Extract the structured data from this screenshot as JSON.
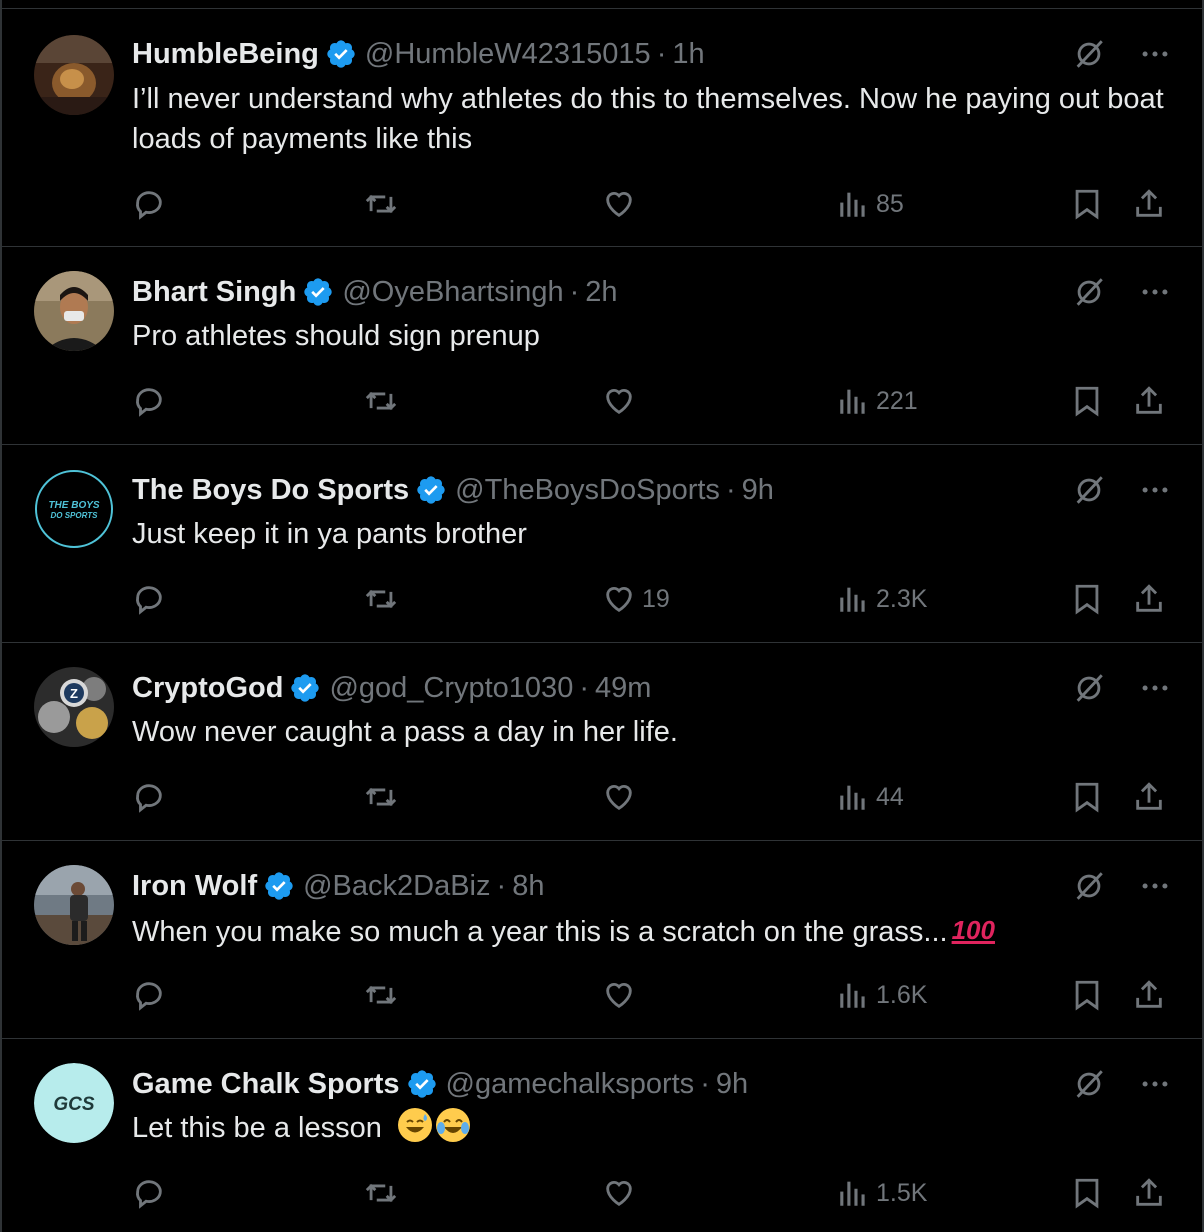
{
  "colors": {
    "background": "#000000",
    "divider": "#2f3336",
    "text": "#e7e9ea",
    "muted": "#71767b",
    "verified": "#1d9bf0"
  },
  "icons": [
    "verified-badge-icon",
    "grok-icon",
    "more-icon",
    "reply-icon",
    "retweet-icon",
    "like-icon",
    "views-icon",
    "bookmark-icon",
    "share-icon"
  ],
  "tweets": [
    {
      "name": "HumbleBeing",
      "handle": "@HumbleW42315015",
      "sep": "·",
      "time": "1h",
      "text": "I’ll never understand why athletes do this to themselves. Now he paying out boat loads of payments like this",
      "likes": "",
      "views": "85"
    },
    {
      "name": "Bhart Singh",
      "handle": "@OyeBhartsingh",
      "sep": "·",
      "time": "2h",
      "text": "Pro athletes should sign prenup",
      "likes": "",
      "views": "221"
    },
    {
      "name": "The Boys Do Sports",
      "handle": "@TheBoysDoSports",
      "sep": "·",
      "time": "9h",
      "text": "Just keep it in ya pants brother",
      "likes": "19",
      "views": "2.3K",
      "avatar_text": [
        "THE BOYS",
        "DO SPORTS"
      ]
    },
    {
      "name": "CryptoGod",
      "handle": "@god_Crypto1030",
      "sep": "·",
      "time": "49m",
      "text": "Wow never caught a pass a day in her life.",
      "likes": "",
      "views": "44",
      "avatar_text": [
        "Z"
      ]
    },
    {
      "name": "Iron Wolf",
      "handle": "@Back2DaBiz",
      "sep": "·",
      "time": "8h",
      "text": "When you make so much a year this is a scratch on the grass...",
      "emoji": "100",
      "likes": "",
      "views": "1.6K"
    },
    {
      "name": "Game Chalk Sports",
      "handle": "@gamechalksports",
      "sep": "·",
      "time": "9h",
      "text": "Let this be a lesson",
      "likes": "",
      "views": "1.5K",
      "avatar_text": [
        "GCS"
      ]
    }
  ]
}
